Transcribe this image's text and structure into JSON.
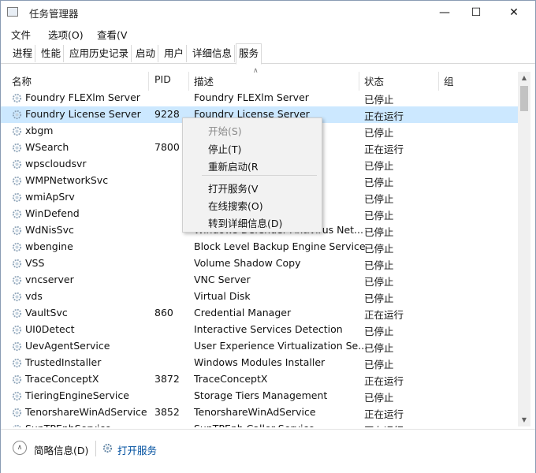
{
  "window": {
    "title": "任务管理器",
    "minimize_icon": "minimize-icon",
    "maximize_icon": "maximize-icon",
    "close_icon": "close-icon"
  },
  "menu": {
    "items": [
      "文件",
      "选项(O)",
      "查看(V"
    ]
  },
  "tabs": [
    "进程",
    "性能",
    "应用历史记录",
    "启动",
    "用户",
    "详细信息",
    "服务"
  ],
  "active_tab": "服务",
  "columns": {
    "name": "名称",
    "pid": "PID",
    "desc": "描述",
    "status": "状态",
    "group": "组"
  },
  "rows": [
    {
      "name": "Foundry FLEXlm Server",
      "pid": "",
      "desc": "Foundry FLEXlm Server",
      "status": "已停止"
    },
    {
      "name": "Foundry License Server",
      "pid": "9228",
      "desc": "Foundry License Server",
      "status": "正在运行"
    },
    {
      "name": "xbgm",
      "pid": "",
      "desc": "",
      "status": "已停止"
    },
    {
      "name": "WSearch",
      "pid": "7800",
      "desc": "",
      "status": "正在运行"
    },
    {
      "name": "wpscloudsvr",
      "pid": "",
      "desc": "",
      "status": "已停止"
    },
    {
      "name": "WMPNetworkSvc",
      "pid": "",
      "desc": "work ...",
      "status": "已停止"
    },
    {
      "name": "wmiApSrv",
      "pid": "",
      "desc": "",
      "status": "已停止"
    },
    {
      "name": "WinDefend",
      "pid": "",
      "desc": "s Serv...",
      "status": "已停止"
    },
    {
      "name": "WdNisSvc",
      "pid": "",
      "desc": "Windows Defender Antivirus Net...",
      "status": "已停止"
    },
    {
      "name": "wbengine",
      "pid": "",
      "desc": "Block Level Backup Engine Service",
      "status": "已停止"
    },
    {
      "name": "VSS",
      "pid": "",
      "desc": "Volume Shadow Copy",
      "status": "已停止"
    },
    {
      "name": "vncserver",
      "pid": "",
      "desc": "VNC Server",
      "status": "已停止"
    },
    {
      "name": "vds",
      "pid": "",
      "desc": "Virtual Disk",
      "status": "已停止"
    },
    {
      "name": "VaultSvc",
      "pid": "860",
      "desc": "Credential Manager",
      "status": "正在运行"
    },
    {
      "name": "UI0Detect",
      "pid": "",
      "desc": "Interactive Services Detection",
      "status": "已停止"
    },
    {
      "name": "UevAgentService",
      "pid": "",
      "desc": "User Experience Virtualization Se...",
      "status": "已停止"
    },
    {
      "name": "TrustedInstaller",
      "pid": "",
      "desc": "Windows Modules Installer",
      "status": "已停止"
    },
    {
      "name": "TraceConceptX",
      "pid": "3872",
      "desc": "TraceConceptX",
      "status": "正在运行"
    },
    {
      "name": "TieringEngineService",
      "pid": "",
      "desc": "Storage Tiers Management",
      "status": "已停止"
    },
    {
      "name": "TenorshareWinAdService",
      "pid": "3852",
      "desc": "TenorshareWinAdService",
      "status": "正在运行"
    },
    {
      "name": "SunTPEnhService",
      "pid": "",
      "desc": "SunTPEnh Caller Service",
      "status": "正在运行"
    }
  ],
  "selected_row": 1,
  "context_menu": {
    "start": "开始(S)",
    "stop": "停止(T)",
    "restart": "重新启动(R",
    "open_services": "打开服务(V",
    "search_online": "在线搜索(O)",
    "go_to_details": "转到详细信息(D)"
  },
  "footer": {
    "brief_info": "简略信息(D)",
    "open_services": "打开服务"
  },
  "colors": {
    "selection": "#cce8ff",
    "link": "#0050a0"
  },
  "icons": {
    "service_row": "gear-icon",
    "brief": "chevron-up-icon"
  }
}
